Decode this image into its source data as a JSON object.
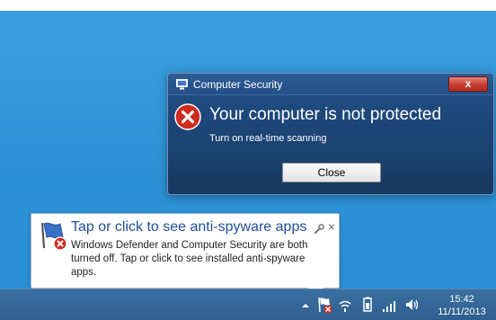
{
  "dialog": {
    "title": "Computer Security",
    "close_glyph": "x",
    "heading": "Your computer is not protected",
    "subtext": "Turn on real-time scanning",
    "button_label": "Close",
    "icon": "error-icon"
  },
  "balloon": {
    "title": "Tap or click to see anti-spyware apps",
    "body": "Windows Defender and Computer Security are both turned off. Tap or click to see installed anti-spyware apps.",
    "close_glyph": "×",
    "icon": "action-center-flag-icon",
    "options_icon": "wrench-icon"
  },
  "taskbar": {
    "time": "15:42",
    "date": "11/11/2013",
    "tray_icons": [
      "chevron-up-icon",
      "action-center-flag-icon",
      "network-icon",
      "battery-icon",
      "signal-icon",
      "volume-icon"
    ]
  },
  "colors": {
    "desktop": "#2c92d6",
    "dialog_bg": "#1c4474",
    "close_red": "#c43c2f",
    "taskbar": "#2f5f90",
    "balloon_title": "#1e4f9a"
  }
}
